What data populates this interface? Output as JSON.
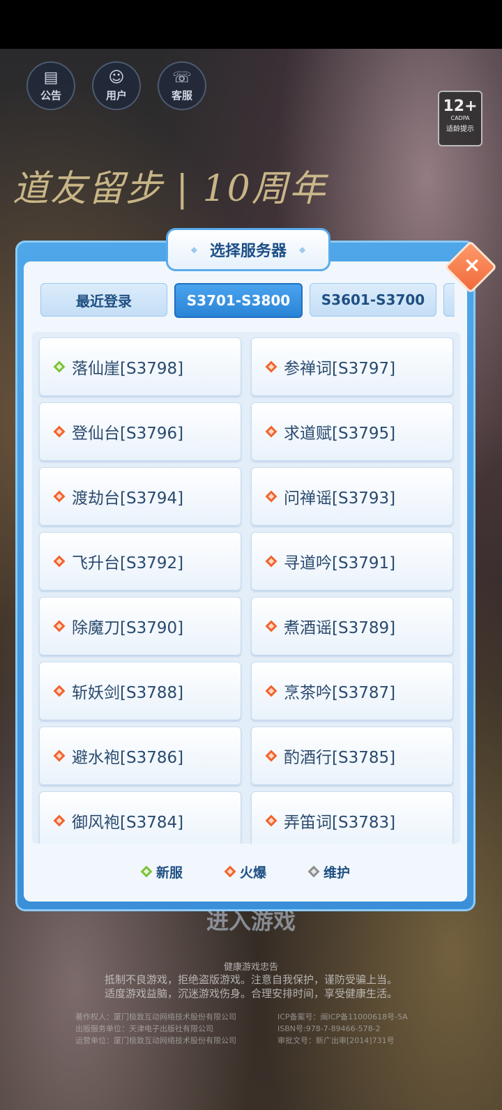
{
  "top_icons": [
    {
      "label": "公告",
      "icon": "notice-board-icon",
      "glyph": "▤"
    },
    {
      "label": "用户",
      "icon": "user-icon",
      "glyph": "☺"
    },
    {
      "label": "客服",
      "icon": "support-chat-icon",
      "glyph": "☏"
    }
  ],
  "age_rating": {
    "value": "12+",
    "org": "CADPA",
    "tip": "适龄提示"
  },
  "logo_text": "道友留步 | 10周年",
  "dialog": {
    "title": "选择服务器",
    "close_glyph": "×",
    "tabs": [
      "最近登录",
      "S3701-S3800",
      "S3601-S3700",
      ""
    ],
    "active_tab": 1,
    "servers": [
      {
        "name": "落仙崖[S3798]",
        "status": "green"
      },
      {
        "name": "参禅词[S3797]",
        "status": "red"
      },
      {
        "name": "登仙台[S3796]",
        "status": "red"
      },
      {
        "name": "求道赋[S3795]",
        "status": "red"
      },
      {
        "name": "渡劫台[S3794]",
        "status": "red"
      },
      {
        "name": "问禅谣[S3793]",
        "status": "red"
      },
      {
        "name": "飞升台[S3792]",
        "status": "red"
      },
      {
        "name": "寻道吟[S3791]",
        "status": "red"
      },
      {
        "name": "除魔刀[S3790]",
        "status": "red"
      },
      {
        "name": "煮酒谣[S3789]",
        "status": "red"
      },
      {
        "name": "斩妖剑[S3788]",
        "status": "red"
      },
      {
        "name": "烹茶吟[S3787]",
        "status": "red"
      },
      {
        "name": "避水袍[S3786]",
        "status": "red"
      },
      {
        "name": "酌酒行[S3785]",
        "status": "red"
      },
      {
        "name": "御风袍[S3784]",
        "status": "red"
      },
      {
        "name": "弄笛词[S3783]",
        "status": "red"
      }
    ],
    "legend": [
      {
        "label": "新服",
        "status": "green"
      },
      {
        "label": "火爆",
        "status": "red"
      },
      {
        "label": "维护",
        "status": "grey"
      }
    ]
  },
  "enter_game": "进入游戏",
  "health_notice": {
    "heading": "健康游戏忠告",
    "line1": "抵制不良游戏，拒绝盗版游戏。注意自我保护，谨防受骗上当。",
    "line2": "适度游戏益脑，沉迷游戏伤身。合理安排时间，享受健康生活。"
  },
  "credits": [
    "著作权人：厦门极致互动网络技术股份有限公司",
    "ICP备案号：闽ICP备11000618号-5A",
    "出版服务单位：天津电子出版社有限公司",
    "ISBN号:978-7-89466-578-2",
    "运营单位：厦门极致互动网络技术股份有限公司",
    "审批文号：新广出审[2014]731号"
  ],
  "colors": {
    "status_green": "#7cc23a",
    "status_red": "#f0642e",
    "status_grey": "#8e8e8e",
    "accent": "#2a84d6"
  }
}
